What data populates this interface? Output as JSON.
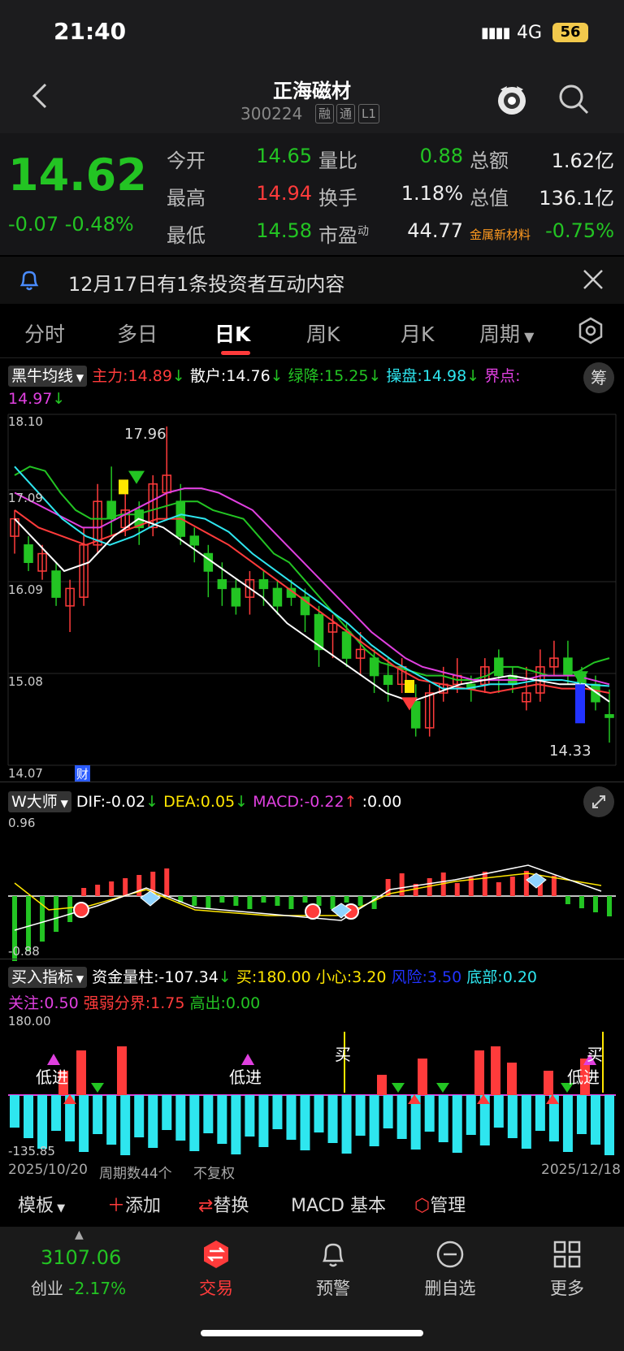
{
  "status": {
    "time": "21:40",
    "network": "4G",
    "battery": "56"
  },
  "header": {
    "title": "正海磁材",
    "code": "300224",
    "tags": [
      "融",
      "通",
      "L1"
    ]
  },
  "quote": {
    "price": "14.62",
    "change": "-0.07",
    "change_pct": "-0.48%",
    "rows": [
      {
        "l1": "今开",
        "v1": "14.65",
        "l2": "量比",
        "v2": "0.88",
        "l3": "总额",
        "v3": "1.62亿"
      },
      {
        "l1": "最高",
        "v1": "14.94",
        "l2": "换手",
        "v2": "1.18%",
        "l3": "总值",
        "v3": "136.1亿"
      },
      {
        "l1": "最低",
        "v1": "14.58",
        "l2": "市盈",
        "l2sup": "动",
        "v2": "44.77",
        "l3": "金属新材料",
        "v3": "-0.75%"
      }
    ]
  },
  "notice": {
    "text": "12月17日有1条投资者互动内容"
  },
  "tabs": [
    "分时",
    "多日",
    "日K",
    "周K",
    "月K",
    "周期"
  ],
  "active_tab": "日K",
  "main_indicator": {
    "name": "黑牛均线",
    "items": [
      {
        "label": "主力:14.89",
        "color": "#ff3b3b"
      },
      {
        "label": "散户:14.76",
        "color": "#ffffff"
      },
      {
        "label": "绿降:15.25",
        "color": "#23c423"
      },
      {
        "label": "操盘:14.98",
        "color": "#2ee6ef"
      },
      {
        "label": "界点:",
        "color": "#e040e0"
      }
    ],
    "second_line": "14.97",
    "badge": "筹"
  },
  "price_axis": [
    "18.10",
    "17.09",
    "16.09",
    "15.08",
    "14.07"
  ],
  "price_marks": {
    "high": "17.96",
    "low": "14.33",
    "cai": "财"
  },
  "macd": {
    "name": "W大师",
    "dif": "DIF:-0.02",
    "dea": "DEA:0.05",
    "macd": "MACD:-0.22",
    "zero": ":0.00",
    "axis_top": "0.96",
    "axis_bottom": "-0.88"
  },
  "buy_indicator": {
    "name": "买入指标",
    "line1": [
      {
        "label": "资金量柱:-107.34",
        "color": "#ffffff"
      },
      {
        "label": "买:180.00",
        "color": "#ffe600"
      },
      {
        "label": "小心:3.20",
        "color": "#ffe600"
      },
      {
        "label": "风险:3.50",
        "color": "#2233ff"
      },
      {
        "label": "底部:0.20",
        "color": "#2ee6ef"
      }
    ],
    "line2": [
      {
        "label": "关注:0.50",
        "color": "#e040e0"
      },
      {
        "label": "强弱分界:1.75",
        "color": "#ff3b3b"
      },
      {
        "label": "高出:0.00",
        "color": "#23c423"
      }
    ],
    "axis_top": "180.00",
    "axis_bottom": "-135.85",
    "labels": {
      "low_in": "低进",
      "buy": "买"
    }
  },
  "date_bar": {
    "start": "2025/10/20",
    "period": "周期数44个",
    "adjust": "不复权",
    "end": "2025/12/18"
  },
  "toolbar": {
    "template": "模板",
    "add": "添加",
    "replace": "替换",
    "macd": "MACD 基本",
    "manage": "管理"
  },
  "bottom_nav": {
    "index_value": "3107.06",
    "index_name": "创业",
    "index_pct": "-2.17%",
    "items": [
      "交易",
      "预警",
      "删自选",
      "更多"
    ]
  },
  "colors": {
    "up": "#ff3b3b",
    "down": "#23c423",
    "bg": "#000000",
    "accent_active": "#ff3b3b"
  }
}
